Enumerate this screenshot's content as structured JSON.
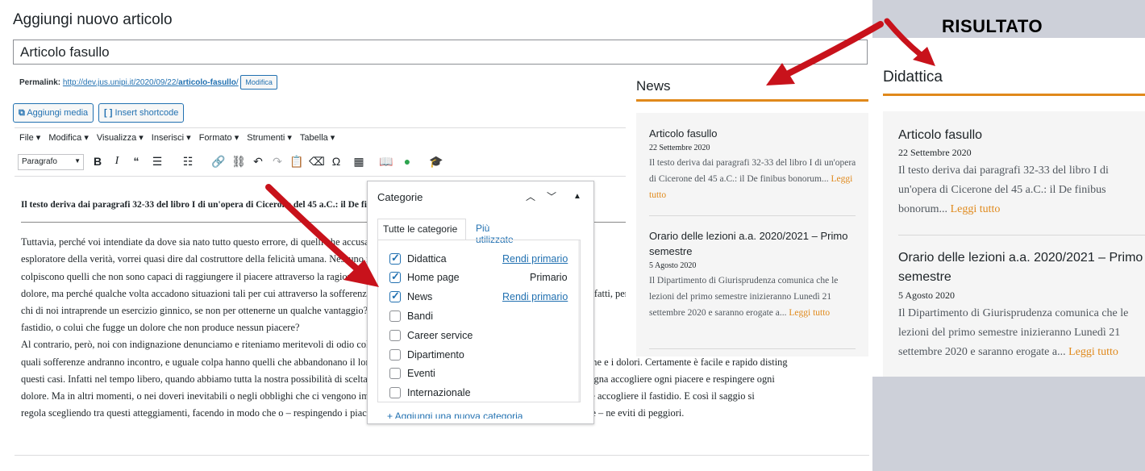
{
  "editor": {
    "page_title": "Aggiungi nuovo articolo",
    "title_value": "Articolo fasullo",
    "permalink_label": "Permalink:",
    "permalink_base": "http://dev.jus.unipi.it/2020/09/22/",
    "permalink_slug": "articolo-fasullo",
    "permalink_end": "/",
    "modifica_label": "Modifica",
    "add_media_label": "Aggiungi media",
    "insert_shortcode_label": "Insert shortcode",
    "menus": [
      "File ▾",
      "Modifica ▾",
      "Visualizza ▾",
      "Inserisci ▾",
      "Formato ▾",
      "Strumenti ▾",
      "Tabella ▾"
    ],
    "format_select": "Paragrafo",
    "content_bold": "Il testo deriva dai paragrafi 32-33 del libro I di un'opera di Cicerone del 45 a.C.: il De finibus bonorum et malorum de finibus bonorum et mal",
    "content_lines": [
      "Tuttavia, perché voi intendiate da dove sia nato tutto questo errore, di quelli che accusano il piacere ed esaltano il dolore, io spiegherò tutta",
      "esploratore della verità, vorrei quasi dire dal costruttore della felicità umana. Nessuno infatti detesta, odia o rifugge il piacere in quanto tal",
      "colpiscono quelli che non sono capaci di raggiungere il piacere attraverso la ragione; e non c'è nessuno che ami, insegua, voglia raggiungere il",
      "dolore, ma perché qualche volta accadono situazioni tali per cui attraverso la sofferenza e il dolore si cerca di raggiungere un grande piacere. Infatti, per scendere",
      "chi di noi intraprende un esercizio ginnico, se non per ottenerne un qualche vantaggio? Chi potrebbe biasimare colui che vuole godere o colui c",
      "fastidio, o colui che fugge un dolore che non produce nessun piacere?",
      "Al contrario, però, noi con indignazione denunciamo e riteniamo meritevoli di odio coloro che, allettati e corrotti dalle lusinghe del momento,",
      "quali sofferenze andranno incontro, e uguale colpa hanno quelli che abbandonano il loro dovere per debolezza d'animo, cioè per evitare le fatiche e i dolori. Certamente è facile e rapido disting",
      "questi casi. Infatti nel tempo libero, quando abbiamo tutta la nostra possibilità di scelta e niente ci impedisce di fare ciò che ci piace di più, bisogna accogliere ogni piacere e respingere ogni",
      "dolore. Ma in altri momenti, o nei doveri inevitabili o negli obblighi che ci vengono imposti, spesso accadrà che si debba respingere il piacere e accogliere il fastidio. E così il saggio si",
      "regola scegliendo tra questi atteggiamenti, facendo in modo che o – respingendo i piaceri – ne ottenga altri più grandi, o – sopportando il dolore – ne eviti di peggiori."
    ]
  },
  "categories": {
    "title": "Categorie",
    "tab_all": "Tutte le categorie",
    "tab_used": "Più utilizzate",
    "items": [
      {
        "label": "Didattica",
        "checked": true,
        "action": "Rendi primario"
      },
      {
        "label": "Home page",
        "checked": true,
        "action": "Primario"
      },
      {
        "label": "News",
        "checked": true,
        "action": "Rendi primario"
      },
      {
        "label": "Bandi",
        "checked": false,
        "action": ""
      },
      {
        "label": "Career service",
        "checked": false,
        "action": ""
      },
      {
        "label": "Dipartimento",
        "checked": false,
        "action": ""
      },
      {
        "label": "Eventi",
        "checked": false,
        "action": ""
      },
      {
        "label": "Internazionale",
        "checked": false,
        "action": ""
      }
    ],
    "add_link": "+ Aggiungi una nuova categoria"
  },
  "result_label": "RISULTATO",
  "news": {
    "heading": "News",
    "posts": [
      {
        "title": "Articolo fasullo",
        "date": "22 Settembre 2020",
        "excerpt": "Il testo deriva dai paragrafi 32-33 del libro I di un'opera di Cicerone del 45 a.C.: il De finibus bonorum...",
        "more": "Leggi tutto"
      },
      {
        "title": "Orario delle lezioni a.a. 2020/2021 – Primo semestre",
        "date": "5 Agosto 2020",
        "excerpt": "Il Dipartimento di Giurisprudenza comunica che le lezioni del primo semestre inizieranno Lunedì 21 settembre 2020 e saranno erogate a...",
        "more": "Leggi tutto"
      }
    ]
  },
  "didattica": {
    "heading": "Didattica",
    "posts": [
      {
        "title": "Articolo fasullo",
        "date": "22 Settembre 2020",
        "excerpt": "Il testo deriva dai paragrafi 32-33 del libro I di un'opera di Cicerone del 45 a.C.: il De finibus bonorum...",
        "more": "Leggi tutto"
      },
      {
        "title": "Orario delle lezioni a.a. 2020/2021 – Primo semestre",
        "date": "5 Agosto 2020",
        "excerpt": "Il Dipartimento di Giurisprudenza comunica che le lezioni del primo semestre inizieranno Lunedì 21 settembre 2020 e saranno erogate a...",
        "more": "Leggi tutto"
      }
    ]
  },
  "colors": {
    "accent": "#e0891b",
    "link": "#2271b1",
    "arrow": "#c8121b",
    "panel_bg": "#cdd0d9"
  }
}
